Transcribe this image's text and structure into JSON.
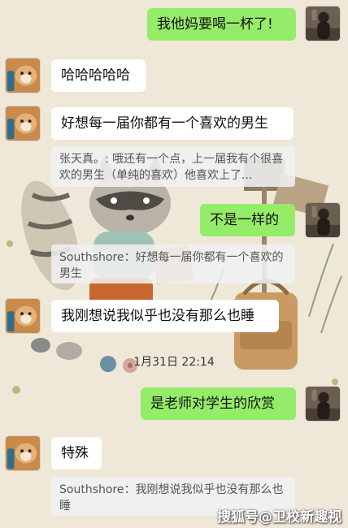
{
  "timestamp": "1月31日 22:14",
  "messages": [
    {
      "text": "我他妈要喝一杯了!"
    },
    {
      "text": "哈哈哈哈哈"
    },
    {
      "text": "好想每一届你都有一个喜欢的男生"
    },
    {
      "quote": "张天真。: 哦还有一个点，上一届我有个很喜欢的男生（单纯的喜欢）他喜欢上了..."
    },
    {
      "text": "不是一样的"
    },
    {
      "quote": "Southshore：好想每一届你都有一个喜欢的男生"
    },
    {
      "text": "我刚想说我似乎也没有那么也睡"
    },
    {
      "text": "是老师对学生的欣赏"
    },
    {
      "text": "特殊"
    },
    {
      "quote": "Southshore：我刚想说我似乎也没有那么也睡"
    }
  ],
  "watermark": "搜狐号@卫校新趣视",
  "colors": {
    "outgoing": "#95ec69",
    "incoming": "#ffffff",
    "background": "#efe8d8"
  }
}
